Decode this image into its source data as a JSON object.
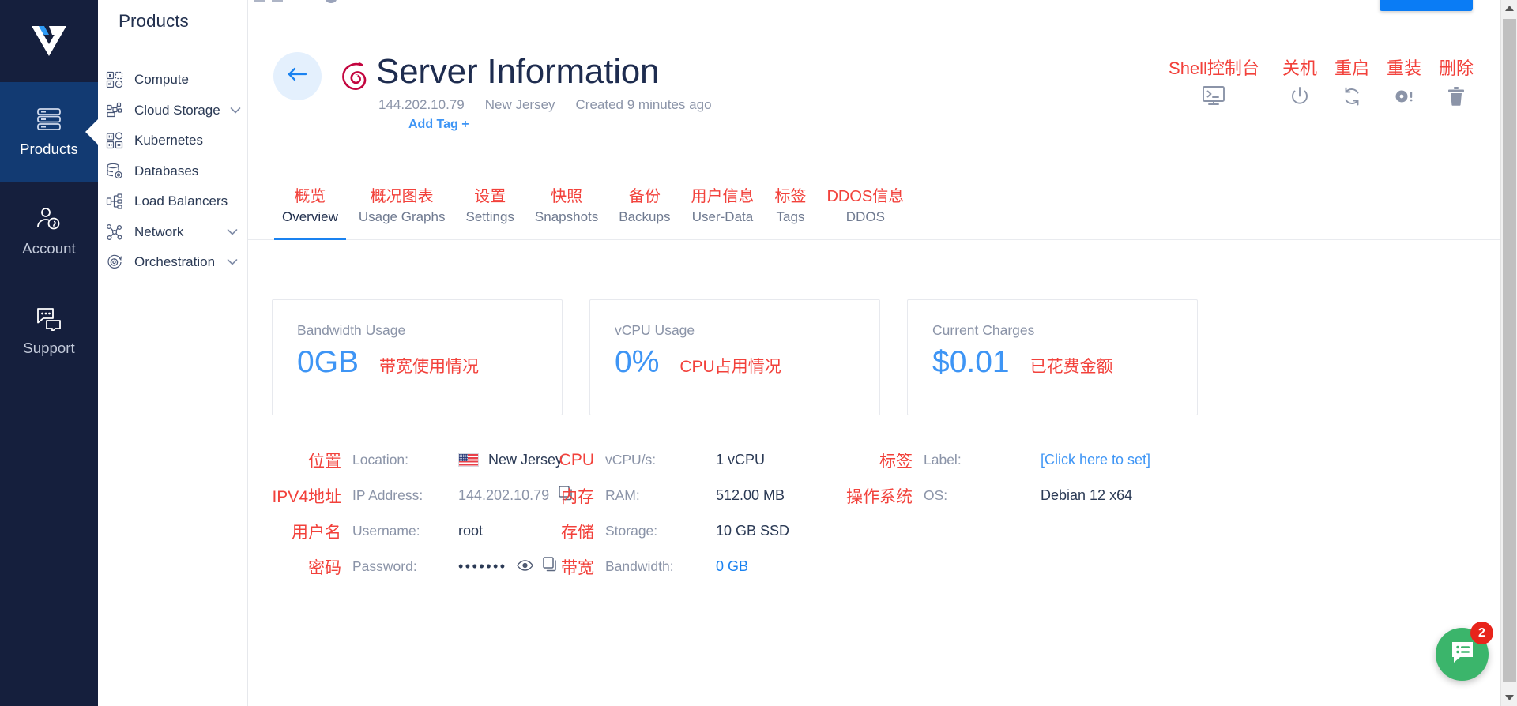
{
  "rail": {
    "logo_name": "vultr-logo",
    "items": [
      {
        "label": "Products",
        "icon": "server-stack-icon",
        "active": true
      },
      {
        "label": "Account",
        "icon": "user-account-icon",
        "active": false
      },
      {
        "label": "Support",
        "icon": "chat-support-icon",
        "active": false
      }
    ]
  },
  "products_panel": {
    "header": "Products",
    "items": [
      {
        "label": "Compute",
        "icon": "compute-icon",
        "chevron": false
      },
      {
        "label": "Cloud Storage",
        "icon": "cloud-storage-icon",
        "chevron": true
      },
      {
        "label": "Kubernetes",
        "icon": "kubernetes-icon",
        "chevron": false
      },
      {
        "label": "Databases",
        "icon": "database-icon",
        "chevron": false
      },
      {
        "label": "Load Balancers",
        "icon": "load-balancer-icon",
        "chevron": false
      },
      {
        "label": "Network",
        "icon": "network-icon",
        "chevron": true
      },
      {
        "label": "Orchestration",
        "icon": "orchestration-icon",
        "chevron": true
      }
    ]
  },
  "header": {
    "back_icon": "arrow-left-icon",
    "os_icon": "debian-swirl-icon",
    "title": "Server Information",
    "ip": "144.202.10.79",
    "region": "New Jersey",
    "created": "Created 9 minutes ago",
    "add_tag": "Add Tag +"
  },
  "actions": [
    {
      "zh": "Shell控制台",
      "icon": "shell-console-icon"
    },
    {
      "zh": "关机",
      "icon": "power-icon"
    },
    {
      "zh": "重启",
      "icon": "restart-icon"
    },
    {
      "zh": "重装",
      "icon": "reinstall-disc-icon"
    },
    {
      "zh": "删除",
      "icon": "trash-icon"
    }
  ],
  "tabs": [
    {
      "zh": "概览",
      "en": "Overview",
      "active": true
    },
    {
      "zh": "概况图表",
      "en": "Usage Graphs",
      "active": false
    },
    {
      "zh": "设置",
      "en": "Settings",
      "active": false
    },
    {
      "zh": "快照",
      "en": "Snapshots",
      "active": false
    },
    {
      "zh": "备份",
      "en": "Backups",
      "active": false
    },
    {
      "zh": "用户信息",
      "en": "User-Data",
      "active": false
    },
    {
      "zh": "标签",
      "en": "Tags",
      "active": false
    },
    {
      "zh": "DDOS信息",
      "en": "DDOS",
      "active": false
    }
  ],
  "cards": [
    {
      "title": "Bandwidth Usage",
      "value": "0GB",
      "zh": "带宽使用情况"
    },
    {
      "title": "vCPU Usage",
      "value": "0%",
      "zh": "CPU占用情况"
    },
    {
      "title": "Current Charges",
      "value": "$0.01",
      "zh": "已花费金额"
    }
  ],
  "details": {
    "col1": [
      {
        "zh": "位置",
        "key": "Location:",
        "value": "New Jersey",
        "style": "flag"
      },
      {
        "zh": "IPV4地址",
        "key": "IP Address:",
        "value": "144.202.10.79",
        "style": "muted-copy"
      },
      {
        "zh": "用户名",
        "key": "Username:",
        "value": "root",
        "style": "plain"
      },
      {
        "zh": "密码",
        "key": "Password:",
        "value": "•••••••",
        "style": "password"
      }
    ],
    "col2": [
      {
        "zh": "CPU",
        "key": "vCPU/s:",
        "value": "1 vCPU",
        "style": "plain"
      },
      {
        "zh": "内存",
        "key": "RAM:",
        "value": "512.00 MB",
        "style": "plain"
      },
      {
        "zh": "存储",
        "key": "Storage:",
        "value": "10 GB SSD",
        "style": "plain"
      },
      {
        "zh": "带宽",
        "key": "Bandwidth:",
        "value": "0 GB",
        "style": "blue"
      }
    ],
    "col3": [
      {
        "zh": "标签",
        "key": "Label:",
        "value": "[Click here to set]",
        "style": "link"
      },
      {
        "zh": "操作系统",
        "key": "OS:",
        "value": "Debian 12 x64",
        "style": "plain"
      }
    ]
  },
  "chat": {
    "badge_count": "2",
    "icon": "chat-message-icon"
  },
  "colors": {
    "rail_bg": "#151f3d",
    "rail_active": "#123a72",
    "accent_blue": "#3e95f5",
    "annotation_red": "#f2413b",
    "tab_underline": "#1a82f0",
    "chat_green": "#3bb56b",
    "badge_red": "#e8241b"
  }
}
